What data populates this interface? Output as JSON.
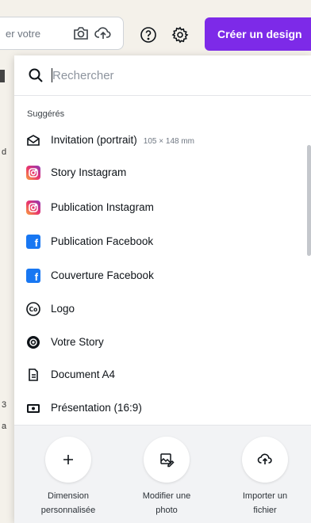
{
  "topbar": {
    "search_placeholder": "er votre",
    "create_label": "Créer un design"
  },
  "page_fragments": [
    "d",
    "3",
    "a"
  ],
  "panel": {
    "search_placeholder": "Rechercher",
    "section_label": "Suggérés",
    "items": [
      {
        "label": "Invitation (portrait)",
        "dimension": "105 × 148 mm",
        "icon": "envelope-icon"
      },
      {
        "label": "Story Instagram",
        "icon": "instagram-icon"
      },
      {
        "label": "Publication Instagram",
        "icon": "instagram-icon"
      },
      {
        "label": "Publication Facebook",
        "icon": "facebook-icon"
      },
      {
        "label": "Couverture Facebook",
        "icon": "facebook-icon"
      },
      {
        "label": "Logo",
        "icon": "logo-co-icon"
      },
      {
        "label": "Votre Story",
        "icon": "camera-icon"
      },
      {
        "label": "Document A4",
        "icon": "document-icon"
      },
      {
        "label": "Présentation (16:9)",
        "icon": "presentation-icon"
      }
    ]
  },
  "actions": [
    {
      "line1": "Dimension",
      "line2": "personnalisée",
      "icon": "plus-icon"
    },
    {
      "line1": "Modifier une",
      "line2": "photo",
      "icon": "edit-photo-icon"
    },
    {
      "line1": "Importer un",
      "line2": "fichier",
      "icon": "upload-cloud-icon"
    }
  ],
  "colors": {
    "accent": "#7d2ae8",
    "facebook": "#1877f2"
  }
}
